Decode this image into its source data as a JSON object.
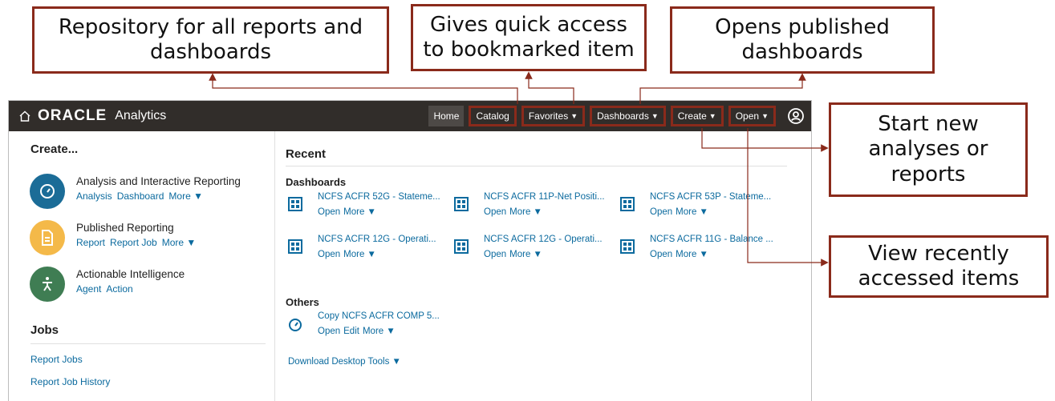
{
  "callouts": {
    "catalog": "Repository for all reports and\ndashboards",
    "favorites": "Gives quick access\nto bookmarked item",
    "dashboards": "Opens published\ndashboards",
    "create": "Start new\nanalyses or\nreports",
    "open": "View recently\naccessed items"
  },
  "header": {
    "brand": "ORACLE",
    "product": "Analytics",
    "nav": {
      "home": "Home",
      "catalog": "Catalog",
      "favorites": "Favorites",
      "dashboards": "Dashboards",
      "create": "Create",
      "open": "Open"
    }
  },
  "create": {
    "heading": "Create...",
    "items": [
      {
        "title": "Analysis and Interactive Reporting",
        "links": [
          "Analysis",
          "Dashboard",
          "More ▼"
        ],
        "color": "#1b6c97",
        "icon": "gauge-icon"
      },
      {
        "title": "Published Reporting",
        "links": [
          "Report",
          "Report Job",
          "More ▼"
        ],
        "color": "#f4b949",
        "icon": "document-icon"
      },
      {
        "title": "Actionable Intelligence",
        "links": [
          "Agent",
          "Action"
        ],
        "color": "#3f7d53",
        "icon": "agent-icon"
      }
    ]
  },
  "jobs": {
    "heading": "Jobs",
    "links": [
      "Report Jobs",
      "Report Job History"
    ]
  },
  "recent": {
    "heading": "Recent",
    "dashboards_heading": "Dashboards",
    "dashboards": [
      {
        "title": "NCFS ACFR 52G - Stateme...",
        "links": [
          "Open",
          "More ▼"
        ]
      },
      {
        "title": "NCFS ACFR 11P-Net Positi...",
        "links": [
          "Open",
          "More ▼"
        ]
      },
      {
        "title": "NCFS ACFR 53P - Stateme...",
        "links": [
          "Open",
          "More ▼"
        ]
      },
      {
        "title": "NCFS ACFR 12G - Operati...",
        "links": [
          "Open",
          "More ▼"
        ]
      },
      {
        "title": "NCFS ACFR 12G - Operati...",
        "links": [
          "Open",
          "More ▼"
        ]
      },
      {
        "title": "NCFS ACFR 11G - Balance ...",
        "links": [
          "Open",
          "More ▼"
        ]
      }
    ],
    "others_heading": "Others",
    "others": [
      {
        "title": "Copy NCFS ACFR COMP 5...",
        "links": [
          "Open",
          "Edit",
          "More ▼"
        ]
      }
    ],
    "download": "Download Desktop Tools ▼"
  },
  "colors": {
    "callout_border": "#8a2a1b",
    "topbar": "#312d2a",
    "link": "#0b6a9e"
  }
}
